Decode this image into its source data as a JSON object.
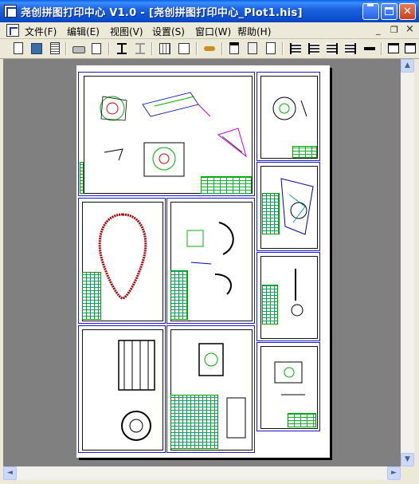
{
  "window": {
    "title": "尧创拼图打印中心 V1.0 - [尧创拼图打印中心_Plot1.his]",
    "minimize_glyph": "_",
    "close_glyph": "✕"
  },
  "menu": {
    "items": [
      {
        "id": "file",
        "label": "文件(F)"
      },
      {
        "id": "edit",
        "label": "编辑(E)"
      },
      {
        "id": "view",
        "label": "视图(V)"
      },
      {
        "id": "settings",
        "label": "设置(S)"
      },
      {
        "id": "window",
        "label": "窗口(W)"
      },
      {
        "id": "help",
        "label": "帮助(H)"
      }
    ],
    "mdi_minimize": "_",
    "mdi_restore": "❐",
    "mdi_close": "×"
  },
  "toolbar": {
    "icons": [
      "new-icon",
      "save-icon",
      "properties-icon",
      "print-icon",
      "print-preview-icon",
      "import-icon",
      "export-icon",
      "grid-icon",
      "refresh-icon",
      "link-icon",
      "page-setup-icon",
      "copy-icon",
      "paste-icon",
      "align-left-icon",
      "align-center-icon",
      "align-right-icon",
      "distribute-icon",
      "move-icon",
      "window-icon",
      "close-view-icon"
    ]
  },
  "scrollbar": {
    "up_glyph": "▲",
    "down_glyph": "▼",
    "left_glyph": "◄",
    "right_glyph": "►"
  },
  "colors": {
    "titlebar": "#0a4fd0",
    "workspace": "#808080",
    "paper": "#ffffff",
    "sheet_border": "#1a1ad0",
    "drawing_green": "#00b000"
  }
}
